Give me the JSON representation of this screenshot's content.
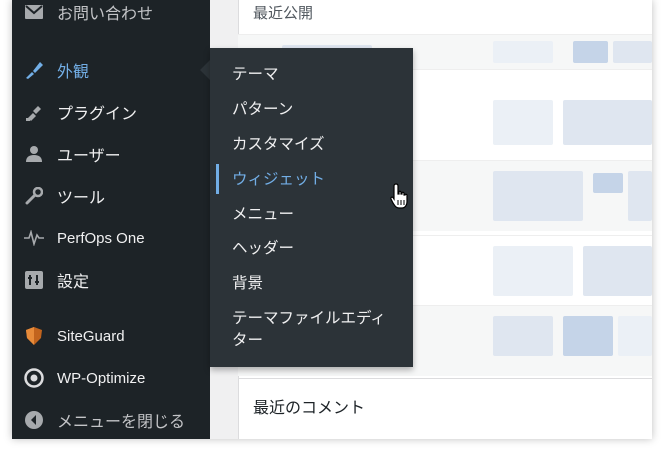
{
  "sidebar": {
    "items": [
      {
        "label": "お問い合わせ",
        "icon": "mail-icon"
      },
      {
        "label": "外観",
        "icon": "appearance-icon",
        "active": true
      },
      {
        "label": "プラグイン",
        "icon": "plugins-icon"
      },
      {
        "label": "ユーザー",
        "icon": "users-icon"
      },
      {
        "label": "ツール",
        "icon": "tools-icon"
      },
      {
        "label": "PerfOps One",
        "icon": "pulse-icon"
      },
      {
        "label": "設定",
        "icon": "settings-icon"
      },
      {
        "label": "SiteGuard",
        "icon": "siteguard-icon"
      },
      {
        "label": "WP-Optimize",
        "icon": "wp-optimize-icon"
      },
      {
        "label": "メニューを閉じる",
        "icon": "collapse-menu-icon"
      }
    ]
  },
  "flyout": {
    "items": [
      {
        "label": "テーマ"
      },
      {
        "label": "パターン"
      },
      {
        "label": "カスタマイズ"
      },
      {
        "label": "ウィジェット",
        "current": true
      },
      {
        "label": "メニュー"
      },
      {
        "label": "ヘッダー"
      },
      {
        "label": "背景"
      },
      {
        "label": "テーマファイルエディター"
      }
    ]
  },
  "main": {
    "recent_title": "最近公開",
    "comments_title": "最近のコメント"
  },
  "colors": {
    "sidebar_bg": "#1d2327",
    "flyout_bg": "#2c3338",
    "accent": "#72aee6"
  }
}
